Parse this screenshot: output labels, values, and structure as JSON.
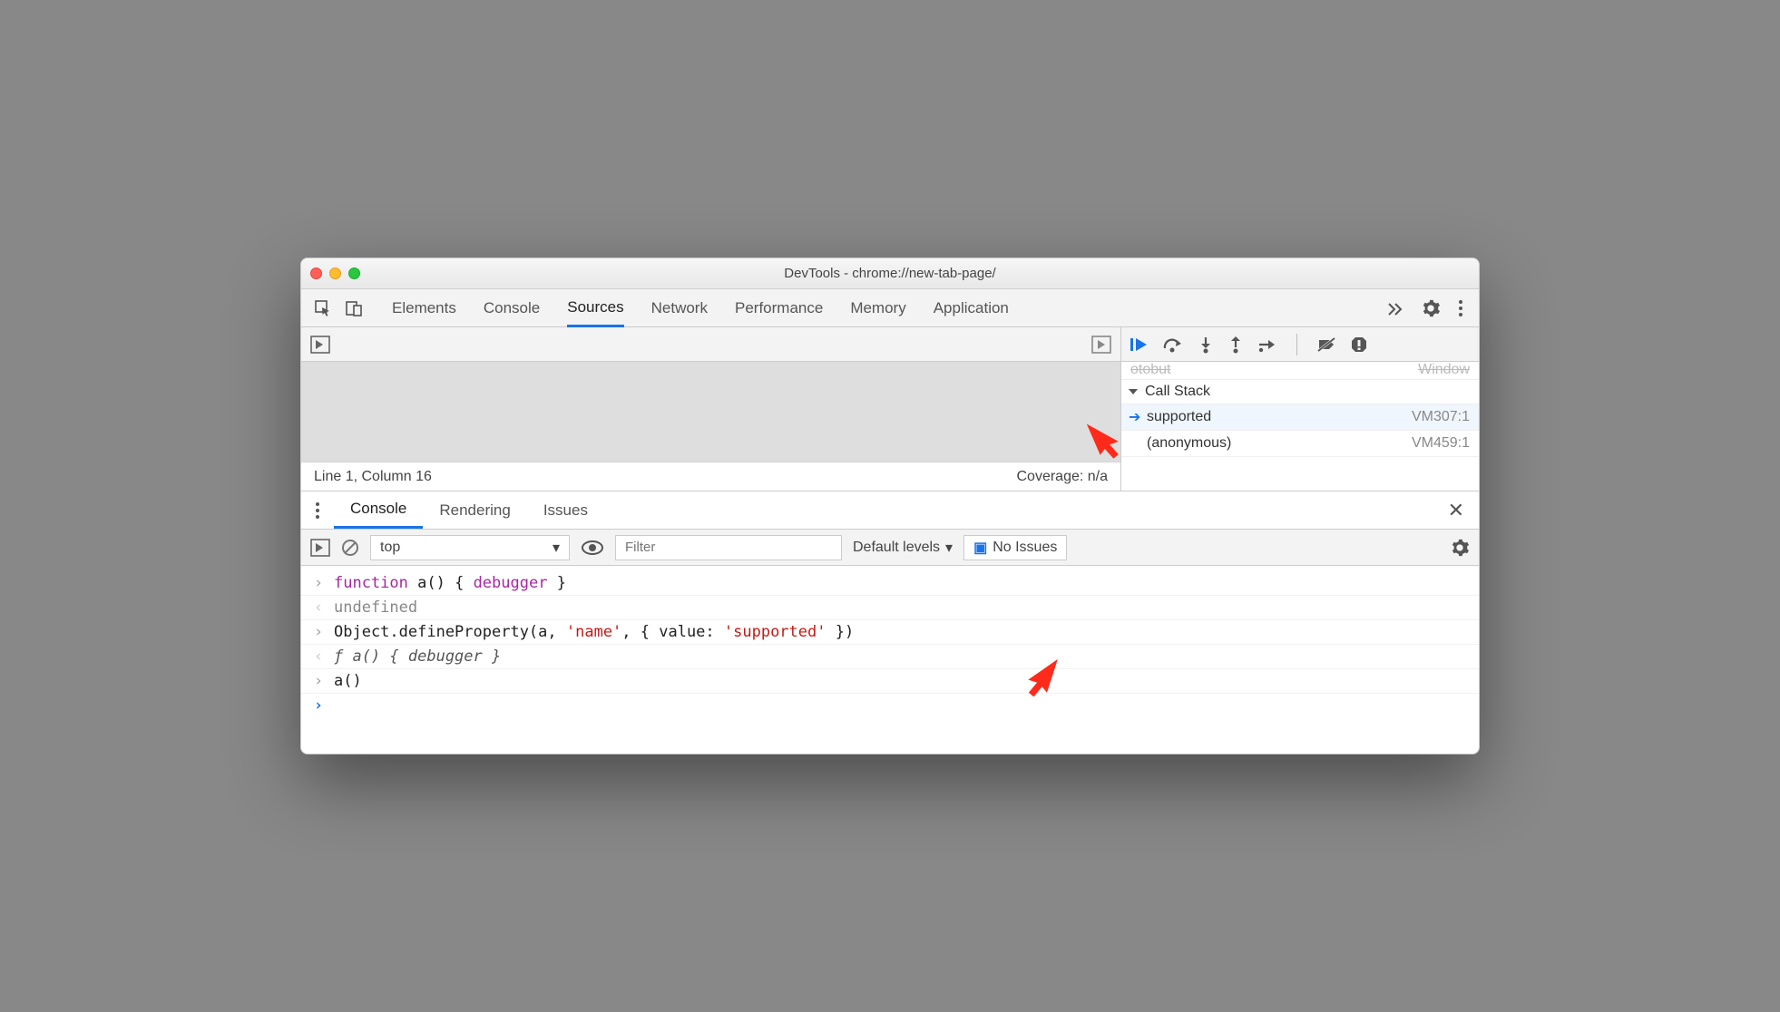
{
  "window": {
    "title": "DevTools - chrome://new-tab-page/"
  },
  "mainTabs": {
    "items": [
      "Elements",
      "Console",
      "Sources",
      "Network",
      "Performance",
      "Memory",
      "Application"
    ],
    "active": "Sources"
  },
  "sourcesStatus": {
    "line_col": "Line 1, Column 16",
    "coverage": "Coverage: n/a"
  },
  "callStack": {
    "header": "Call Stack",
    "frames": [
      {
        "name": "supported",
        "loc": "VM307:1",
        "active": true
      },
      {
        "name": "(anonymous)",
        "loc": "VM459:1",
        "active": false
      }
    ]
  },
  "drawer": {
    "tabs": [
      "Console",
      "Rendering",
      "Issues"
    ],
    "active": "Console"
  },
  "consoleToolbar": {
    "context": "top",
    "filter_placeholder": "Filter",
    "levels": "Default levels",
    "issues": "No Issues"
  },
  "consoleLines": [
    {
      "kind": "in",
      "tokens": [
        [
          "kw",
          "function"
        ],
        [
          "fn",
          " a"
        ],
        [
          "num",
          "() { "
        ],
        [
          "kw",
          "debugger"
        ],
        [
          "num",
          " }"
        ]
      ]
    },
    {
      "kind": "out",
      "tokens": [
        [
          "dim",
          "undefined"
        ]
      ]
    },
    {
      "kind": "in",
      "tokens": [
        [
          "num",
          "Object.defineProperty(a, "
        ],
        [
          "str",
          "'name'"
        ],
        [
          "num",
          ", { value: "
        ],
        [
          "str",
          "'supported'"
        ],
        [
          "num",
          " })"
        ]
      ]
    },
    {
      "kind": "out",
      "tokens": [
        [
          "ital",
          "ƒ a() { debugger }"
        ]
      ]
    },
    {
      "kind": "in",
      "tokens": [
        [
          "num",
          "a()"
        ]
      ]
    }
  ]
}
